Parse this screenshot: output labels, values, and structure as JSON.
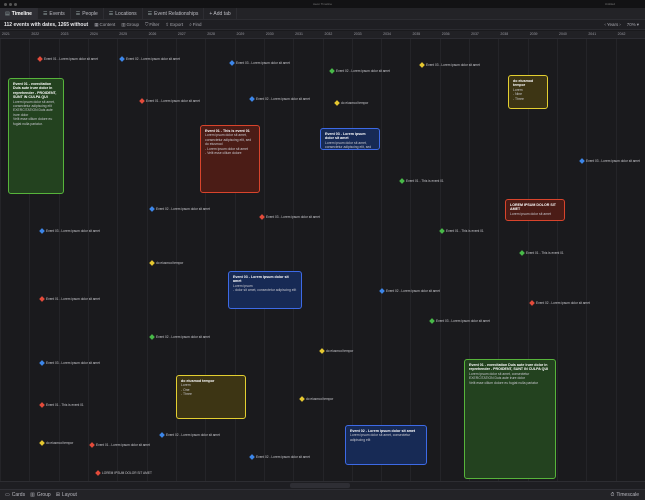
{
  "window": {
    "title": "Aeon Timeline",
    "right_label": "Untitled"
  },
  "tabs": [
    {
      "label": "Timeline",
      "icon": "timeline-icon"
    },
    {
      "label": "Events",
      "icon": "events-icon"
    },
    {
      "label": "People",
      "icon": "people-icon"
    },
    {
      "label": "Locations",
      "icon": "locations-icon"
    },
    {
      "label": "Event Relationships",
      "icon": "relationships-icon"
    },
    {
      "label": "+ Add tab",
      "icon": ""
    }
  ],
  "toolbar": {
    "count": "112 events with dates, 1265 without",
    "content": "Content",
    "group": "Group",
    "filter": "Filter",
    "export": "Export",
    "find": "Find",
    "zoom_unit": "Years",
    "zoom_pct": "70%"
  },
  "years": [
    "2021",
    "2022",
    "2023",
    "2024",
    "2025",
    "2026",
    "2027",
    "2028",
    "2029",
    "2030",
    "2031",
    "2032",
    "2033",
    "2034",
    "2035",
    "2036",
    "2037",
    "2038",
    "2039",
    "2040",
    "2041",
    "2042"
  ],
  "cards": [
    {
      "title": "Event 01 - exercitation Duis aute irure dolor in reprehender - PROIDENT, SUNT IN CULPA QUI",
      "body": [
        "Lorem ipsum dolor sit amet, consectetur adipiscing elit",
        "EXERCITATION Duis aute irure dolor",
        "Velit esse cillum dolore eu fugiat nulla pariatur."
      ],
      "color": "green"
    },
    {
      "title": "Event 01 - This is event 01",
      "body": [
        "Lorem ipsum dolor sit amet, consectetur adipiscing elit, sed do eiusmod",
        "- Lorem ipsum dolor sit amet",
        "- Velit esse cillum dolore"
      ],
      "color": "red"
    },
    {
      "title": "Event 03 - Lorem ipsum dolor sit amet",
      "body": [
        "Lorem ipsum dolor sit amet, consectetur adipiscing elit, sed do eiusmod tempor"
      ],
      "color": "blue"
    },
    {
      "title": "do eiusmod tempor",
      "body": [
        "Lorem",
        "- Nine",
        "- Three"
      ],
      "color": "yellow"
    },
    {
      "title": "Event 01 - This is event 01",
      "body": [
        "Lorem ipsum dolor sit amet, consectetur adipiscing",
        "EXERCITATION Duis aute irure dolor"
      ],
      "color": "red"
    },
    {
      "title": "LOREM IPSUM DOLOR SIT AMET",
      "body": [
        "Lorem ipsum dolor sit amet"
      ],
      "color": "red"
    },
    {
      "title": "Event 03 - Lorem ipsum dolor sit amet",
      "body": [
        "Lorem ipsum",
        "- dolor sit amet, consectetur adipiscing elit"
      ],
      "color": "blue"
    },
    {
      "title": "do eiusmod tempor",
      "body": [
        "Lorem",
        "- One",
        "- Three"
      ],
      "color": "yellow"
    },
    {
      "title": "Event 02 - Lorem ipsum dolor sit amet",
      "body": [
        "Lorem ipsum dolor sit amet, consectetur adipiscing elit"
      ],
      "color": "blue"
    },
    {
      "title": "Event 01 - exercitation Duis aute irure dolor in reprehender - PROIDENT, SUNT IN CULPA QUI",
      "body": [
        "Lorem ipsum dolor sit amet, consectetur",
        "EXERCITATION Duis aute irure dolor",
        "Velit esse cillum dolore eu fugiat nulla pariatur"
      ],
      "color": "green"
    }
  ],
  "events": [
    {
      "label": "Event 01 - Lorem ipsum dolor sit amet",
      "color": "#e34b3a"
    },
    {
      "label": "Event 02 - Lorem ipsum dolor sit amet",
      "color": "#3c86e8"
    },
    {
      "label": "Event 03 - Lorem ipsum dolor sit amet",
      "color": "#3c86e8"
    },
    {
      "label": "Event 02 - Lorem ipsum dolor sit amet",
      "color": "#48b948"
    },
    {
      "label": "Event 03 - Lorem ipsum dolor sit amet",
      "color": "#e5c730"
    },
    {
      "label": "Event 01 - Lorem ipsum dolor sit amet",
      "color": "#e34b3a"
    },
    {
      "label": "Event 02 - Lorem ipsum dolor sit amet",
      "color": "#3c86e8"
    },
    {
      "label": "do eiusmod tempor",
      "color": "#e5c730"
    },
    {
      "label": "Event 01 - This is event 01",
      "color": "#48b948"
    },
    {
      "label": "Event 02 - Lorem ipsum dolor sit amet",
      "color": "#3c86e8"
    },
    {
      "label": "Event 03 - Lorem ipsum dolor sit amet",
      "color": "#e34b3a"
    },
    {
      "label": "do eiusmod tempor",
      "color": "#e5c730"
    },
    {
      "label": "Event 02 - Lorem ipsum dolor sit amet",
      "color": "#3c86e8"
    },
    {
      "label": "Event 01 - This is event 01",
      "color": "#48b948"
    },
    {
      "label": "Event 03 - Lorem ipsum dolor sit amet",
      "color": "#3c86e8"
    },
    {
      "label": "Event 01 - Lorem ipsum dolor sit amet",
      "color": "#e34b3a"
    },
    {
      "label": "do eiusmod tempor",
      "color": "#e5c730"
    },
    {
      "label": "Event 02 - Lorem ipsum dolor sit amet",
      "color": "#48b948"
    },
    {
      "label": "Event 03 - Lorem ipsum dolor sit amet",
      "color": "#3c86e8"
    },
    {
      "label": "Event 01 - This is event 01",
      "color": "#e34b3a"
    },
    {
      "label": "do eiusmod tempor",
      "color": "#e5c730"
    },
    {
      "label": "Event 02 - Lorem ipsum dolor sit amet",
      "color": "#3c86e8"
    },
    {
      "label": "Event 03 - Lorem ipsum dolor sit amet",
      "color": "#48b948"
    },
    {
      "label": "Event 01 - Lorem ipsum dolor sit amet",
      "color": "#e34b3a"
    },
    {
      "label": "Event 02 - Lorem ipsum dolor sit amet",
      "color": "#3c86e8"
    },
    {
      "label": "do eiusmod tempor",
      "color": "#e5c730"
    },
    {
      "label": "Event 03 - Lorem ipsum dolor sit amet",
      "color": "#3c86e8"
    },
    {
      "label": "Event 01 - This is event 01",
      "color": "#48b948"
    },
    {
      "label": "Event 02 - Lorem ipsum dolor sit amet",
      "color": "#e34b3a"
    },
    {
      "label": "LOREM IPSUM DOLOR SIT AMET",
      "color": "#e34b3a"
    }
  ],
  "statusbar": {
    "cards": "Cards",
    "group": "Group",
    "layout": "Layout",
    "timescale": "Timescale"
  }
}
